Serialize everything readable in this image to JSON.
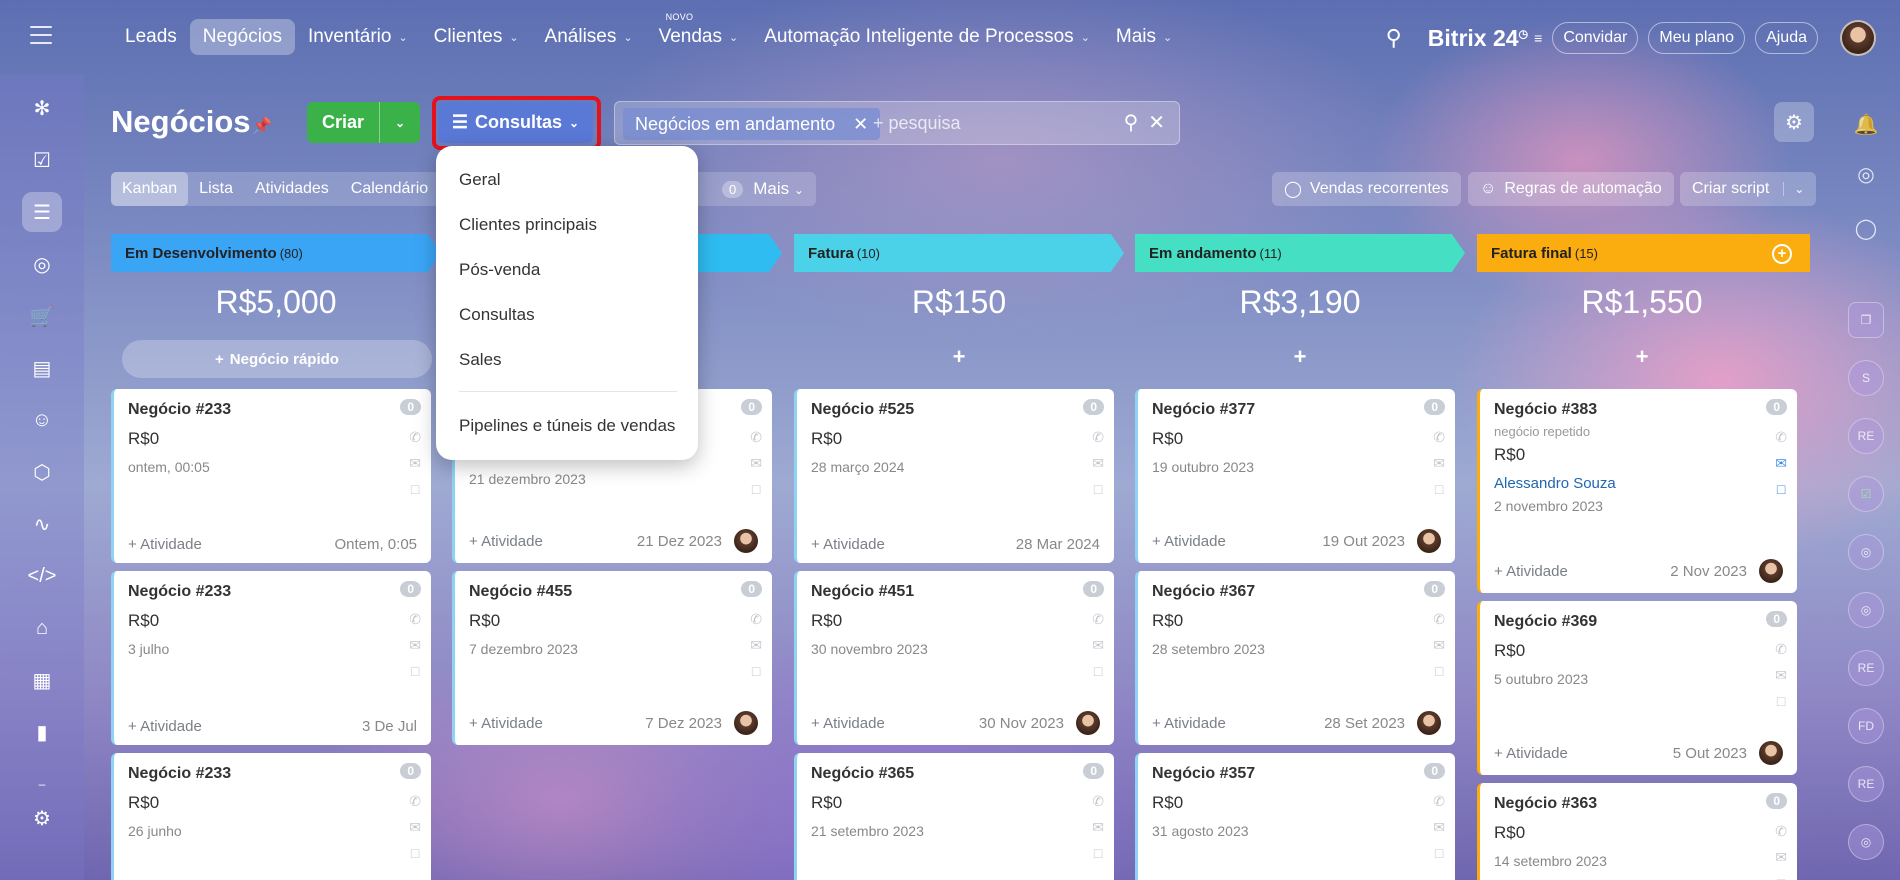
{
  "topnav": {
    "items": [
      {
        "label": "Leads",
        "chev": false,
        "active": false
      },
      {
        "label": "Negócios",
        "chev": false,
        "active": true
      },
      {
        "label": "Inventário",
        "chev": true,
        "active": false
      },
      {
        "label": "Clientes",
        "chev": true,
        "active": false
      },
      {
        "label": "Análises",
        "chev": true,
        "active": false
      },
      {
        "label": "Vendas",
        "chev": true,
        "active": false,
        "badge": "NOVO"
      },
      {
        "label": "Automação Inteligente de Processos",
        "chev": true,
        "active": false
      },
      {
        "label": "Mais",
        "chev": true,
        "active": false
      }
    ],
    "brand": "Bitrix 24",
    "invite": "Convidar",
    "plan": "Meu plano",
    "help": "Ajuda"
  },
  "page": {
    "title": "Negócios",
    "create": "Criar",
    "consultas": "Consultas"
  },
  "search": {
    "chip": "Negócios em andamento",
    "placeholder": "+ pesquisa"
  },
  "views": {
    "tabs": [
      "Kanban",
      "Lista",
      "Atividades",
      "Calendário"
    ],
    "counter": "0",
    "more": "Mais"
  },
  "tools": {
    "recurring": "Vendas recorrentes",
    "automation": "Regras de automação",
    "script": "Criar script"
  },
  "dropdown": {
    "items": [
      "Geral",
      "Clientes principais",
      "Pós-venda",
      "Consultas",
      "Sales"
    ],
    "footer": "Pipelines e túneis de vendas"
  },
  "columns": [
    {
      "name": "Em Desenvolvimento",
      "count": "(80)",
      "sum": "R$5,000",
      "quick": "Negócio rápido",
      "color": "#3aa5f5"
    },
    {
      "name": "",
      "count": "",
      "sum": "",
      "color": "#2fbcf0"
    },
    {
      "name": "Fatura",
      "count": "(10)",
      "sum": "R$150",
      "color": "#4bd2e8"
    },
    {
      "name": "Em andamento",
      "count": "(11)",
      "sum": "R$3,190",
      "color": "#45e0c4"
    },
    {
      "name": "Fatura final",
      "count": "(15)",
      "sum": "R$1,550",
      "color": "#fbac0e"
    }
  ],
  "cards": {
    "c0": [
      {
        "title": "Negócio #233",
        "price": "R$0",
        "date": "ontem, 00:05",
        "act": "+ Atividade",
        "fdate": "Ontem, 0:05",
        "badge": "0"
      },
      {
        "title": "Negócio #233",
        "price": "R$0",
        "date": "3 julho",
        "act": "+ Atividade",
        "fdate": "3 De Jul",
        "badge": "0"
      },
      {
        "title": "Negócio #233",
        "price": "R$0",
        "date": "26 junho",
        "badge": "0"
      }
    ],
    "c1": [
      {
        "date": "21 dezembro 2023",
        "act": "+ Atividade",
        "fdate": "21 Dez 2023",
        "badge": "0"
      },
      {
        "title": "Negócio #455",
        "price": "R$0",
        "date": "7 dezembro 2023",
        "act": "+ Atividade",
        "fdate": "7 Dez 2023",
        "badge": "0"
      }
    ],
    "c2": [
      {
        "title": "Negócio #525",
        "price": "R$0",
        "date": "28 março 2024",
        "act": "+ Atividade",
        "fdate": "28 Mar 2024",
        "badge": "0"
      },
      {
        "title": "Negócio #451",
        "price": "R$0",
        "date": "30 novembro 2023",
        "act": "+ Atividade",
        "fdate": "30 Nov 2023",
        "badge": "0"
      },
      {
        "title": "Negócio #365",
        "price": "R$0",
        "date": "21 setembro 2023",
        "badge": "0"
      }
    ],
    "c3": [
      {
        "title": "Negócio #377",
        "price": "R$0",
        "date": "19 outubro 2023",
        "act": "+ Atividade",
        "fdate": "19 Out 2023",
        "badge": "0"
      },
      {
        "title": "Negócio #367",
        "price": "R$0",
        "date": "28 setembro 2023",
        "act": "+ Atividade",
        "fdate": "28 Set 2023",
        "badge": "0"
      },
      {
        "title": "Negócio #357",
        "price": "R$0",
        "date": "31 agosto 2023",
        "badge": "0"
      }
    ],
    "c4": [
      {
        "title": "Negócio #383",
        "sub": "negócio repetido",
        "price": "R$0",
        "who": "Alessandro Souza",
        "date": "2 novembro 2023",
        "act": "+ Atividade",
        "fdate": "2 Nov 2023",
        "badge": "0"
      },
      {
        "title": "Negócio #369",
        "price": "R$0",
        "date": "5 outubro 2023",
        "act": "+ Atividade",
        "fdate": "5 Out 2023",
        "badge": "0"
      },
      {
        "title": "Negócio #363",
        "price": "R$0",
        "date": "14 setembro 2023",
        "badge": "0"
      }
    ]
  },
  "rightbar": {
    "labels": [
      "S",
      "RE",
      "RE",
      "FD",
      "RE"
    ]
  }
}
